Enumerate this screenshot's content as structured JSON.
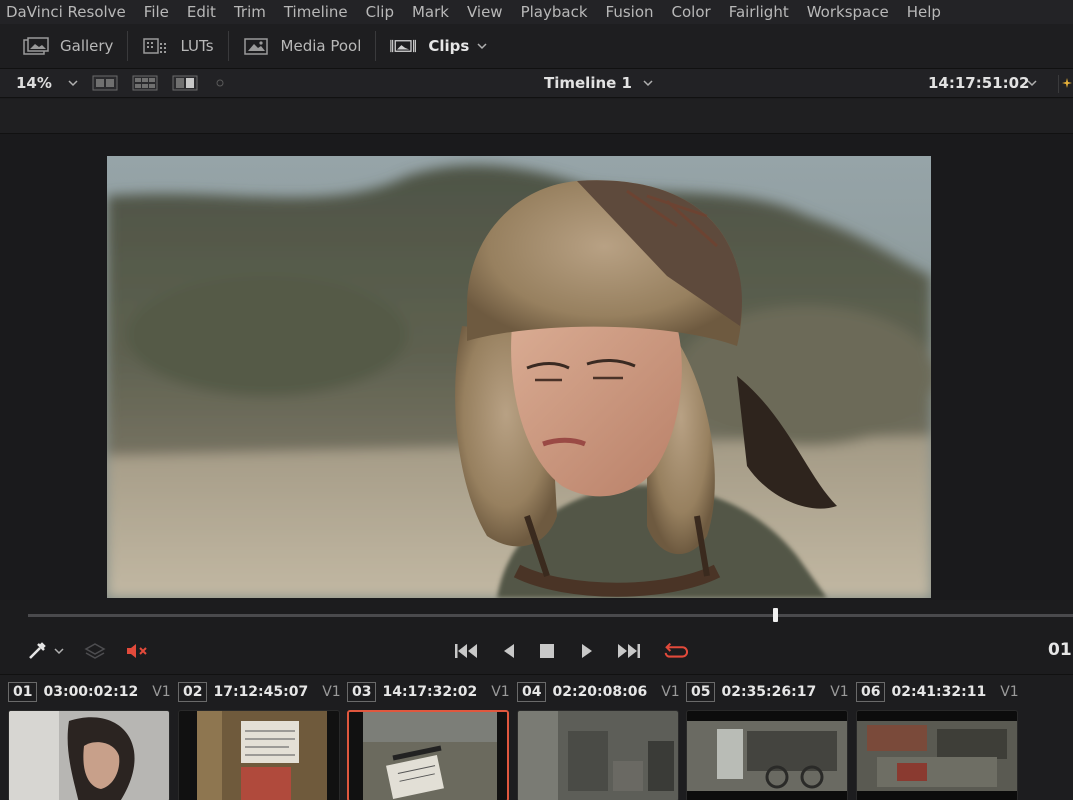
{
  "menu": {
    "items": [
      "DaVinci Resolve",
      "File",
      "Edit",
      "Trim",
      "Timeline",
      "Clip",
      "Mark",
      "View",
      "Playback",
      "Fusion",
      "Color",
      "Fairlight",
      "Workspace",
      "Help"
    ]
  },
  "toolbar": {
    "gallery": "Gallery",
    "luts": "LUTs",
    "media_pool": "Media Pool",
    "clips": "Clips"
  },
  "viewer": {
    "zoom": "14%",
    "timeline_name": "Timeline 1",
    "timecode": "14:17:51:02",
    "playhead_fraction": 0.71
  },
  "transport": {
    "timecode_right": "01"
  },
  "clips": [
    {
      "num": "01",
      "tc": "03:00:02:12",
      "track": "V1",
      "thumb": "portrait"
    },
    {
      "num": "02",
      "tc": "17:12:45:07",
      "track": "V1",
      "thumb": "slate"
    },
    {
      "num": "03",
      "tc": "14:17:32:02",
      "track": "V1",
      "thumb": "slate2",
      "selected": true
    },
    {
      "num": "04",
      "tc": "02:20:08:06",
      "track": "V1",
      "thumb": "room"
    },
    {
      "num": "05",
      "tc": "02:35:26:17",
      "track": "V1",
      "thumb": "bike"
    },
    {
      "num": "06",
      "tc": "02:41:32:11",
      "track": "V1",
      "thumb": "workshop"
    }
  ],
  "colors": {
    "accent_red": "#e0573e",
    "mute_red": "#e24a3b"
  }
}
